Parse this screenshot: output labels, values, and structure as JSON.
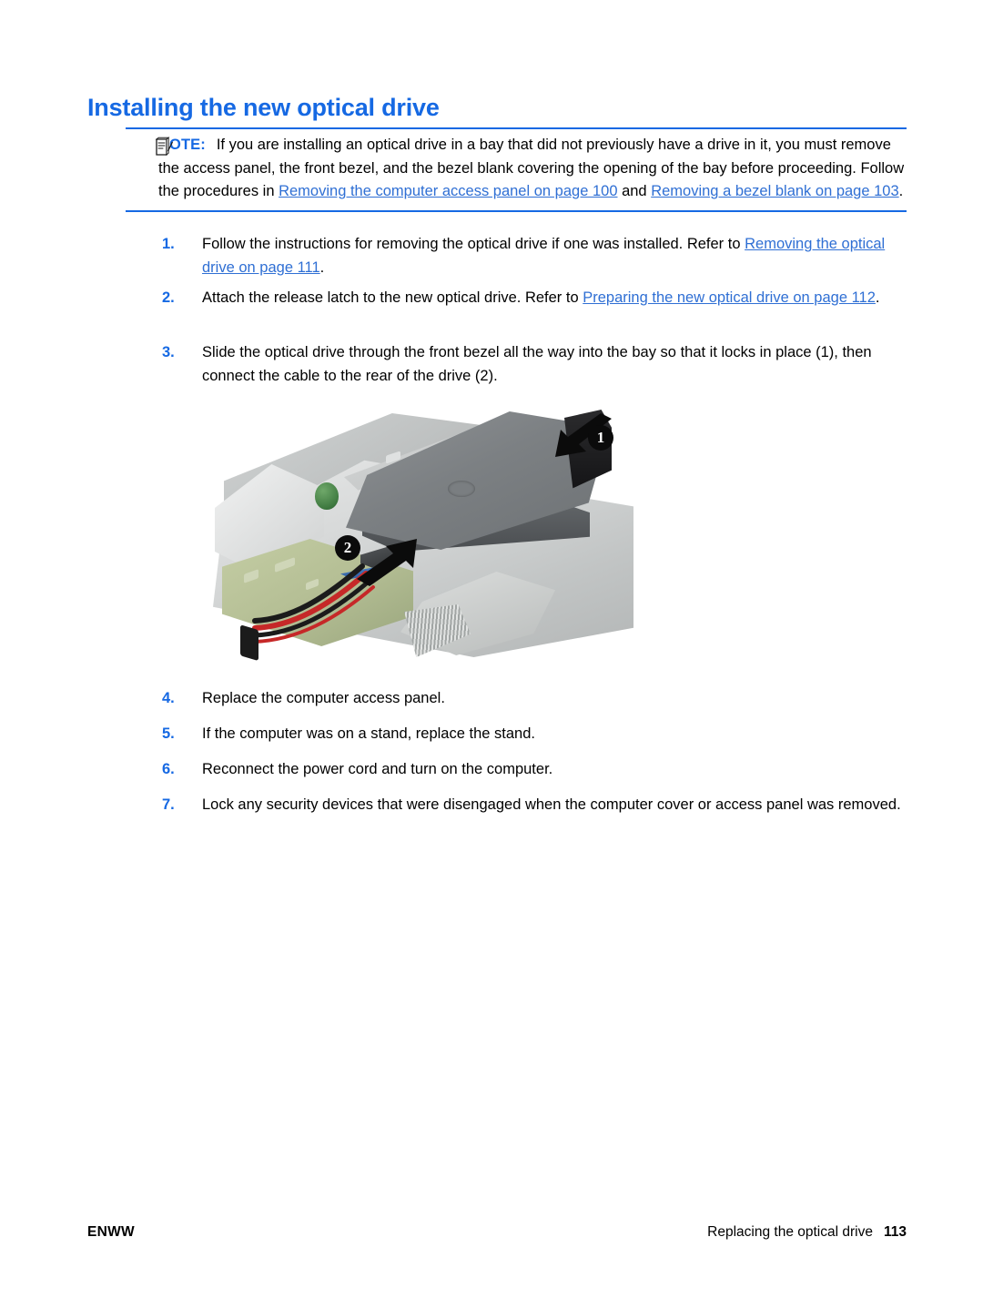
{
  "document": {
    "title": "Installing the new optical drive",
    "title_color": "#1669e3"
  },
  "note": {
    "icon": "note-pad-pencil-icon",
    "label": "NOTE:",
    "text_part_1": "If you are installing an optical drive in a bay that did not previously have a drive in it, you must remove the access panel, the front bezel, and the bezel blank covering the opening of the bay before proceeding. Follow the procedures in ",
    "link_1": "Removing the computer access panel on page 100",
    "text_part_2": " and ",
    "link_2": "Removing a bezel blank on page 103",
    "text_part_3": "."
  },
  "steps": [
    {
      "number": "1.",
      "text_part_1": "Follow the instructions for removing the optical drive if one was installed. Refer to ",
      "link": "Removing the optical drive on page 111",
      "text_part_2": "."
    },
    {
      "number": "2.",
      "text_part_1": "Attach the release latch to the new optical drive. Refer to ",
      "link": "Preparing the new optical drive on page 112",
      "text_part_2": "."
    },
    {
      "number": "3.",
      "text_part_1": "Slide the optical drive through the front bezel all the way into the bay so that it locks in place (1), then connect the cable to the rear of the drive (2).",
      "link": "",
      "text_part_2": ""
    },
    {
      "number": "4.",
      "text_part_1": "Replace the computer access panel.",
      "link": "",
      "text_part_2": ""
    },
    {
      "number": "5.",
      "text_part_1": "If the computer was on a stand, replace the stand.",
      "link": "",
      "text_part_2": ""
    },
    {
      "number": "6.",
      "text_part_1": "Reconnect the power cord and turn on the computer.",
      "link": "",
      "text_part_2": ""
    },
    {
      "number": "7.",
      "text_part_1": "Lock any security devices that were disengaged when the computer cover or access panel was removed.",
      "link": "",
      "text_part_2": ""
    }
  ],
  "figure": {
    "description": "Photo of a desktop computer chassis with an optical drive being slid into the drive bay and a SATA cable connected at the rear",
    "callout_1": "1",
    "callout_2": "2"
  },
  "footer": {
    "left": "ENWW",
    "right": "Replacing the optical drive",
    "page_number": "113"
  }
}
